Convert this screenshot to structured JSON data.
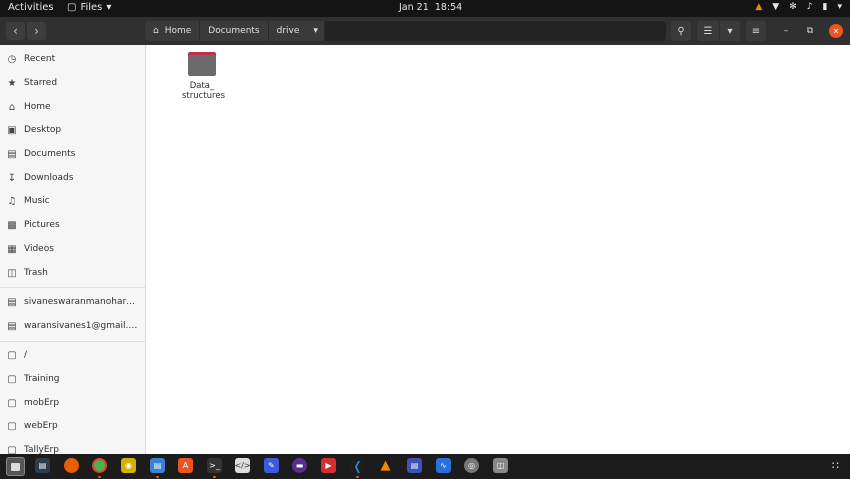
{
  "topbar": {
    "activities": "Activities",
    "app_menu": "Files",
    "date": "Jan 21",
    "time": "18:54"
  },
  "header": {
    "breadcrumbs": [
      "Home",
      "Documents",
      "drive"
    ]
  },
  "sidebar": {
    "places": [
      "Recent",
      "Starred",
      "Home",
      "Desktop",
      "Documents",
      "Downloads",
      "Music",
      "Pictures",
      "Videos",
      "Trash"
    ],
    "accounts": [
      "sivaneswaranmanohara…",
      "waransivanes1@gmail.c…"
    ],
    "devices": [
      "/",
      "Training",
      "mobErp",
      "webErp",
      "TallyErp"
    ]
  },
  "main": {
    "items": [
      {
        "name": "Data_\nstructures",
        "type": "folder"
      }
    ]
  },
  "colors": {
    "accent": "#e95420",
    "folder_tab": "#c0304a",
    "folder_body": "#6b6b6b"
  }
}
